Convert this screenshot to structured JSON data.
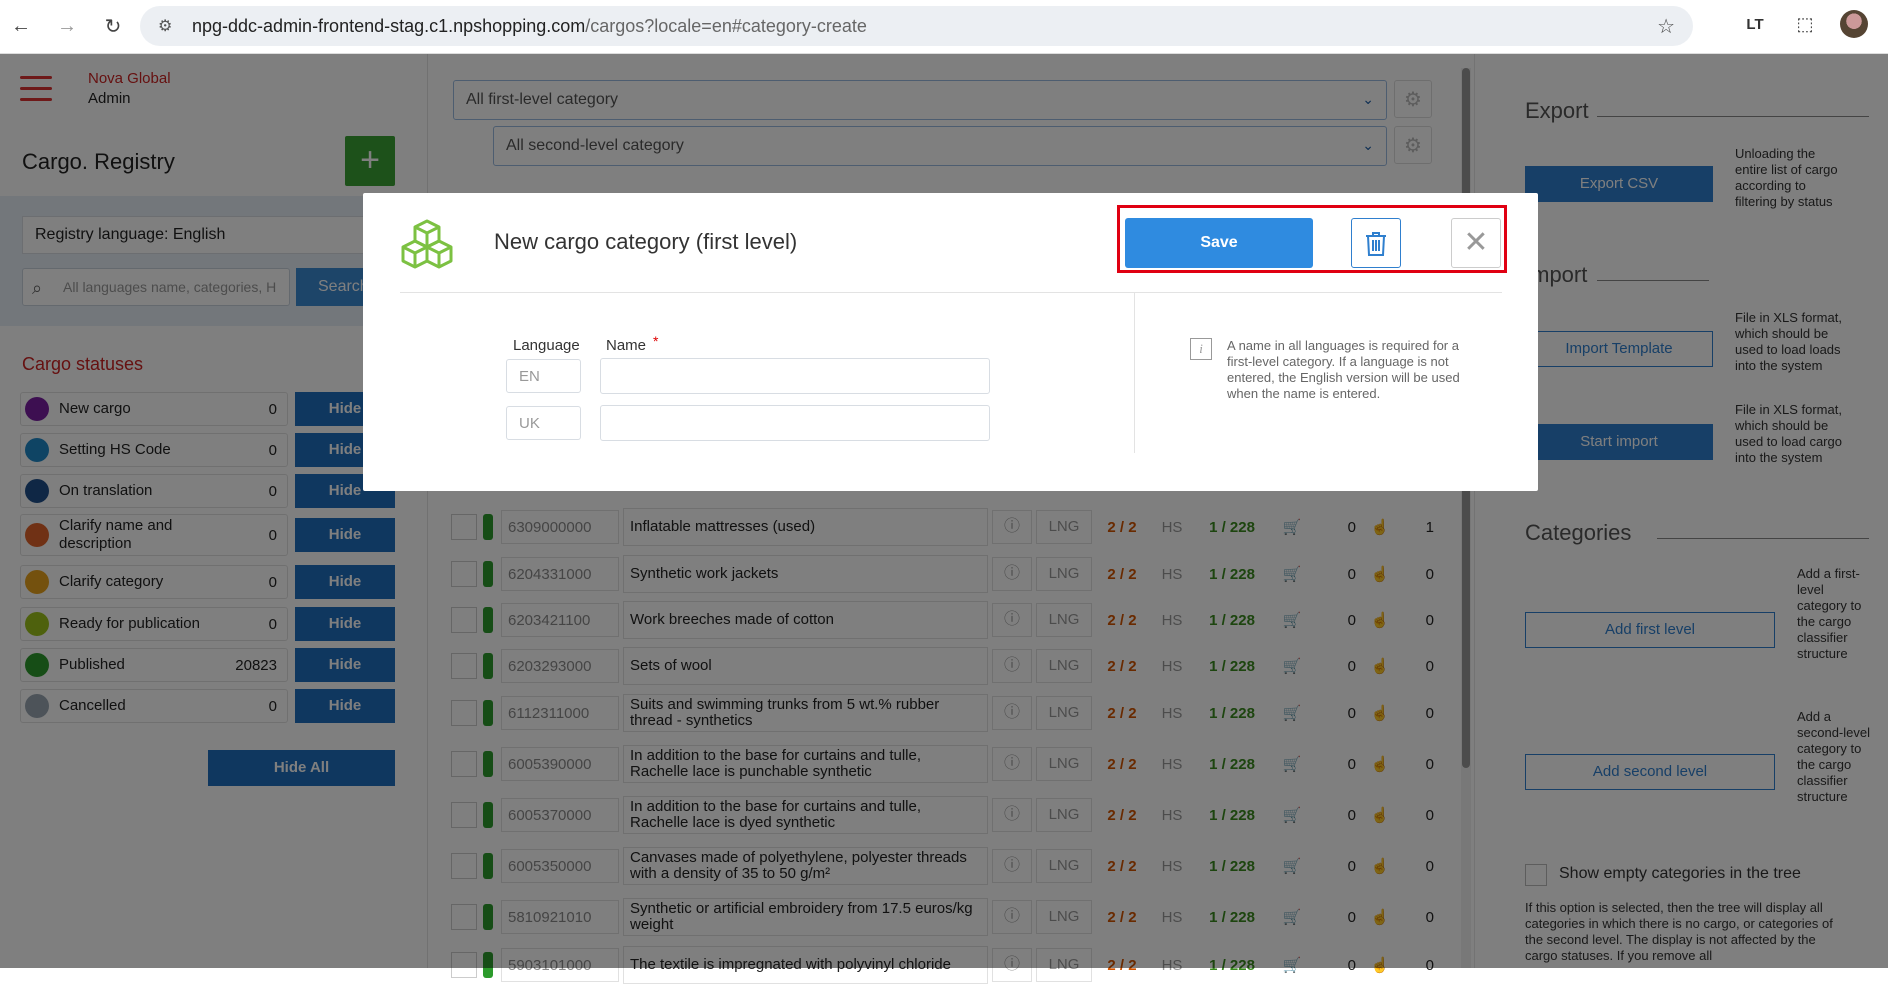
{
  "browser": {
    "url_host": "npg-ddc-admin-frontend-stag.c1.npshopping.com",
    "url_path": "/cargos?locale=en#category-create"
  },
  "sidebar": {
    "brand_line1": "Nova Global",
    "brand_line2": "Admin",
    "title": "Cargo. Registry",
    "add_label": "+",
    "registry_language": "Registry language: English",
    "search_placeholder": "All languages name, categories, H",
    "search_button": "Search",
    "statuses_title": "Cargo statuses",
    "statuses": [
      {
        "label": "New cargo",
        "count": "0",
        "color": "#7b1fa2",
        "hide": "Hide"
      },
      {
        "label": "Setting HS Code",
        "count": "0",
        "color": "#1e88c8",
        "hide": "Hide"
      },
      {
        "label": "On translation",
        "count": "0",
        "color": "#1f4f8a",
        "hide": "Hide"
      },
      {
        "label": "Clarify name and description",
        "count": "0",
        "color": "#e0632a",
        "hide": "Hide"
      },
      {
        "label": "Clarify category",
        "count": "0",
        "color": "#e8a21c",
        "hide": "Hide"
      },
      {
        "label": "Ready for publication",
        "count": "0",
        "color": "#9cc21a",
        "hide": "Hide"
      },
      {
        "label": "Published",
        "count": "20823",
        "color": "#2c9b2c",
        "hide": "Hide"
      },
      {
        "label": "Cancelled",
        "count": "0",
        "color": "#9aa6b2",
        "hide": "Hide"
      }
    ],
    "hide_all": "Hide All"
  },
  "main": {
    "first_level_select": "All first-level category",
    "second_level_select": "All second-level category",
    "rows": [
      {
        "code": "6309000000",
        "name": "Inflatable mattresses (used)",
        "lng": "LNG",
        "ratio": "2 / 2",
        "hs": "HS",
        "ratio2": "1 / 228",
        "n1": "0",
        "n2": "1"
      },
      {
        "code": "6204331000",
        "name": "Synthetic work jackets",
        "lng": "LNG",
        "ratio": "2 / 2",
        "hs": "HS",
        "ratio2": "1 / 228",
        "n1": "0",
        "n2": "0"
      },
      {
        "code": "6203421100",
        "name": "Work breeches made of cotton",
        "lng": "LNG",
        "ratio": "2 / 2",
        "hs": "HS",
        "ratio2": "1 / 228",
        "n1": "0",
        "n2": "0"
      },
      {
        "code": "6203293000",
        "name": "Sets of wool",
        "lng": "LNG",
        "ratio": "2 / 2",
        "hs": "HS",
        "ratio2": "1 / 228",
        "n1": "0",
        "n2": "0"
      },
      {
        "code": "6112311000",
        "name": "Suits and swimming trunks from 5 wt.% rubber thread - synthetics",
        "lng": "LNG",
        "ratio": "2 / 2",
        "hs": "HS",
        "ratio2": "1 / 228",
        "n1": "0",
        "n2": "0"
      },
      {
        "code": "6005390000",
        "name": "In addition to the base for curtains and tulle, Rachelle lace is punchable synthetic",
        "lng": "LNG",
        "ratio": "2 / 2",
        "hs": "HS",
        "ratio2": "1 / 228",
        "n1": "0",
        "n2": "0"
      },
      {
        "code": "6005370000",
        "name": "In addition to the base for curtains and tulle, Rachelle lace is dyed synthetic",
        "lng": "LNG",
        "ratio": "2 / 2",
        "hs": "HS",
        "ratio2": "1 / 228",
        "n1": "0",
        "n2": "0"
      },
      {
        "code": "6005350000",
        "name": "Canvases made of polyethylene, polyester threads with a density of 35 to 50 g/m²",
        "lng": "LNG",
        "ratio": "2 / 2",
        "hs": "HS",
        "ratio2": "1 / 228",
        "n1": "0",
        "n2": "0"
      },
      {
        "code": "5810921010",
        "name": "Synthetic or artificial embroidery from 17.5 euros/kg weight",
        "lng": "LNG",
        "ratio": "2 / 2",
        "hs": "HS",
        "ratio2": "1 / 228",
        "n1": "0",
        "n2": "0"
      },
      {
        "code": "5903101000",
        "name": "The textile is impregnated with polyvinyl chloride",
        "lng": "LNG",
        "ratio": "2 / 2",
        "hs": "HS",
        "ratio2": "1 / 228",
        "n1": "0",
        "n2": "0"
      }
    ]
  },
  "right_panel": {
    "export_title": "Export",
    "export_csv": "Export CSV",
    "export_note": "Unloading the entire list of cargo according to filtering by status",
    "import_title": "Import",
    "import_template": "Import Template",
    "import_template_note": "File in XLS format, which should be used to load loads into the system",
    "start_import": "Start import",
    "start_import_note": "File in XLS format, which should be used to load cargo into the system",
    "categories_title": "Categories",
    "add_first_level": "Add first level",
    "add_first_note": "Add a first-level category to the cargo classifier structure",
    "add_second_level": "Add second level",
    "add_second_note": "Add a second-level category to the cargo classifier structure",
    "show_empty": "Show empty categories in the tree",
    "show_empty_note": "If this option is selected, then the tree will display all categories in which there is no cargo, or categories of the second level. The display is not affected by the cargo statuses. If you remove all"
  },
  "modal": {
    "title": "New cargo category (first level)",
    "save": "Save",
    "language_header": "Language",
    "name_header": "Name",
    "required_mark": "*",
    "languages": [
      {
        "code": "EN",
        "value": ""
      },
      {
        "code": "UK",
        "value": ""
      }
    ],
    "info_text": "A name in all languages is required for a first-level category. If a language is not entered, the English version will be used when the name is entered."
  }
}
